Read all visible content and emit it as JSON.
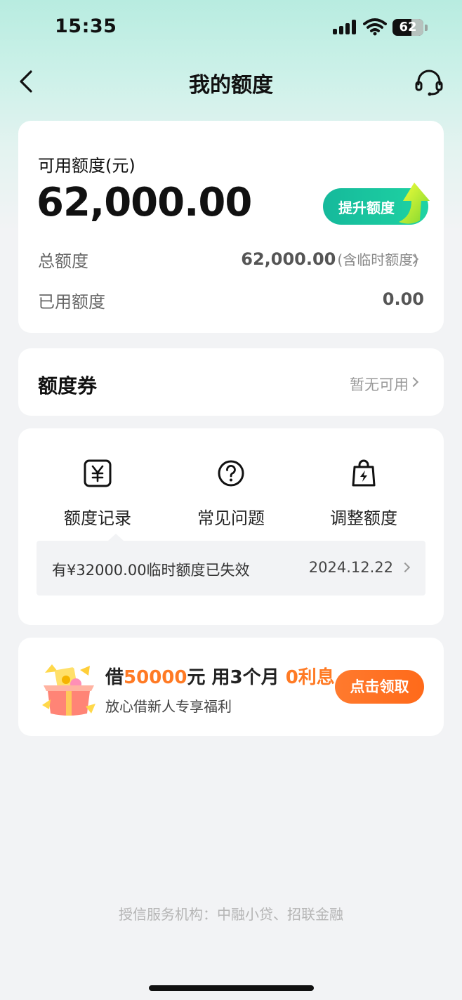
{
  "status_bar": {
    "time": "15:35",
    "battery": "62",
    "battery_level": 0.62
  },
  "nav": {
    "title": "我的额度",
    "back_icon": "chevron-left-icon",
    "service_icon": "headset-icon"
  },
  "quota": {
    "available_label": "可用额度(元)",
    "available_amount": "62,000.00",
    "boost_button": "提升额度",
    "total_label": "总额度",
    "total_value": "62,000.00",
    "total_note": "(含临时额度)",
    "used_label": "已用额度",
    "used_value": "0.00"
  },
  "coupon": {
    "title": "额度券",
    "status": "暂无可用"
  },
  "actions": [
    {
      "label": "额度记录",
      "icon": "yuan-icon"
    },
    {
      "label": "常见问题",
      "icon": "question-icon"
    },
    {
      "label": "调整额度",
      "icon": "bag-lightning-icon"
    }
  ],
  "notice": {
    "text": "有¥32000.00临时额度已失效",
    "date": "2024.12.22"
  },
  "promo": {
    "prefix": "借",
    "amount": "50000",
    "middle": "元 用3个月 ",
    "highlight": "0利息",
    "subtitle": "放心借新人专享福利",
    "button": "点击领取"
  },
  "footer": "授信服务机构：中融小贷、招联金融",
  "colors": {
    "accent_green": "#15b99b",
    "accent_orange": "#ff7a24",
    "background": "#f2f3f5"
  }
}
